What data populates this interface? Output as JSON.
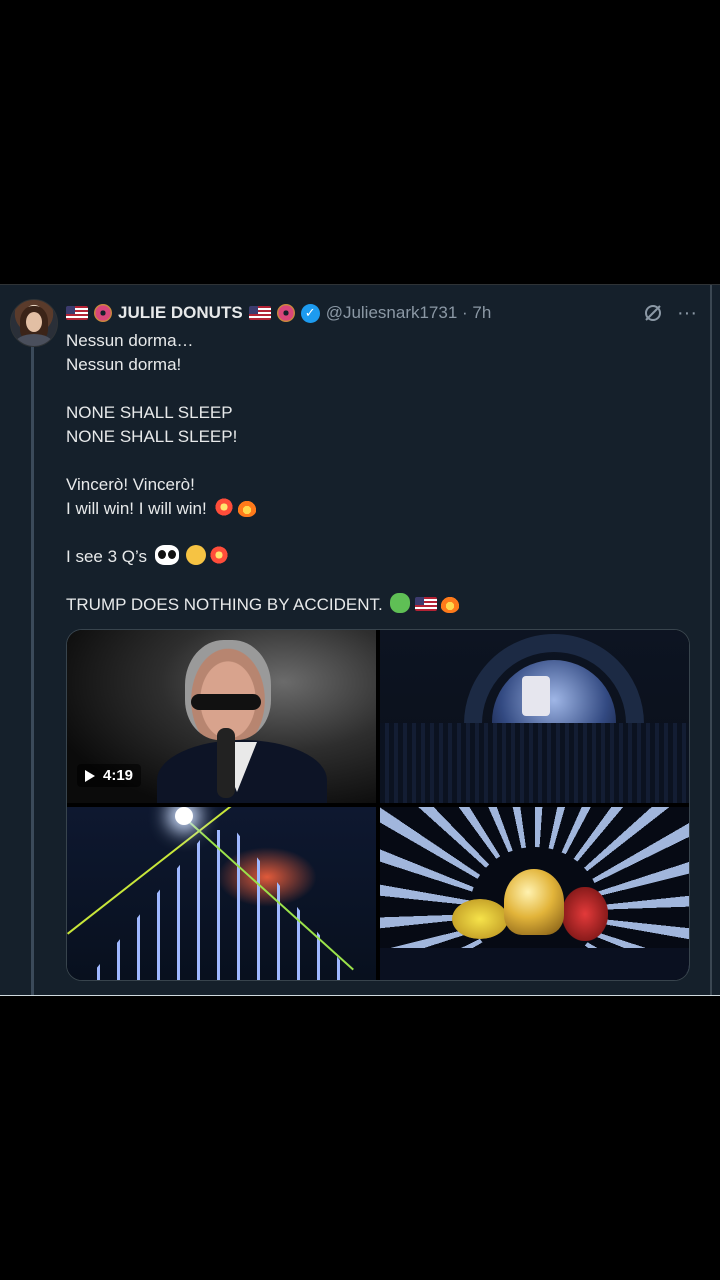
{
  "post": {
    "author_name": "JULIE DONUTS",
    "handle_and_time": "@Juliesnark1731 · 7h",
    "text_lines": {
      "l1": "Nessun dorma…",
      "l2": "Nessun dorma!",
      "l3": "NONE SHALL SLEEP",
      "l4": "NONE SHALL SLEEP!",
      "l5": "Vincerò! Vincerò!",
      "l6": "I will win! I will win!",
      "l7": "I see 3 Q’s",
      "l8": "TRUMP DOES NOTHING BY ACCIDENT."
    },
    "icons": {
      "name_prefix": [
        "us-flag-icon",
        "donut-icon"
      ],
      "name_suffix": [
        "us-flag-icon",
        "donut-icon"
      ],
      "verified": "verified-badge-icon",
      "grok": "grok-icon",
      "more": "more-icon"
    },
    "media": {
      "video_duration": "4:19",
      "tiles": [
        "singer-closeup",
        "stage-arch",
        "stage-laser-beams",
        "trophy-light-rays"
      ]
    },
    "colors": {
      "background": "#15202b",
      "verified": "#1d9bf0",
      "text": "#e7e9ea",
      "muted": "#8b98a5"
    }
  }
}
